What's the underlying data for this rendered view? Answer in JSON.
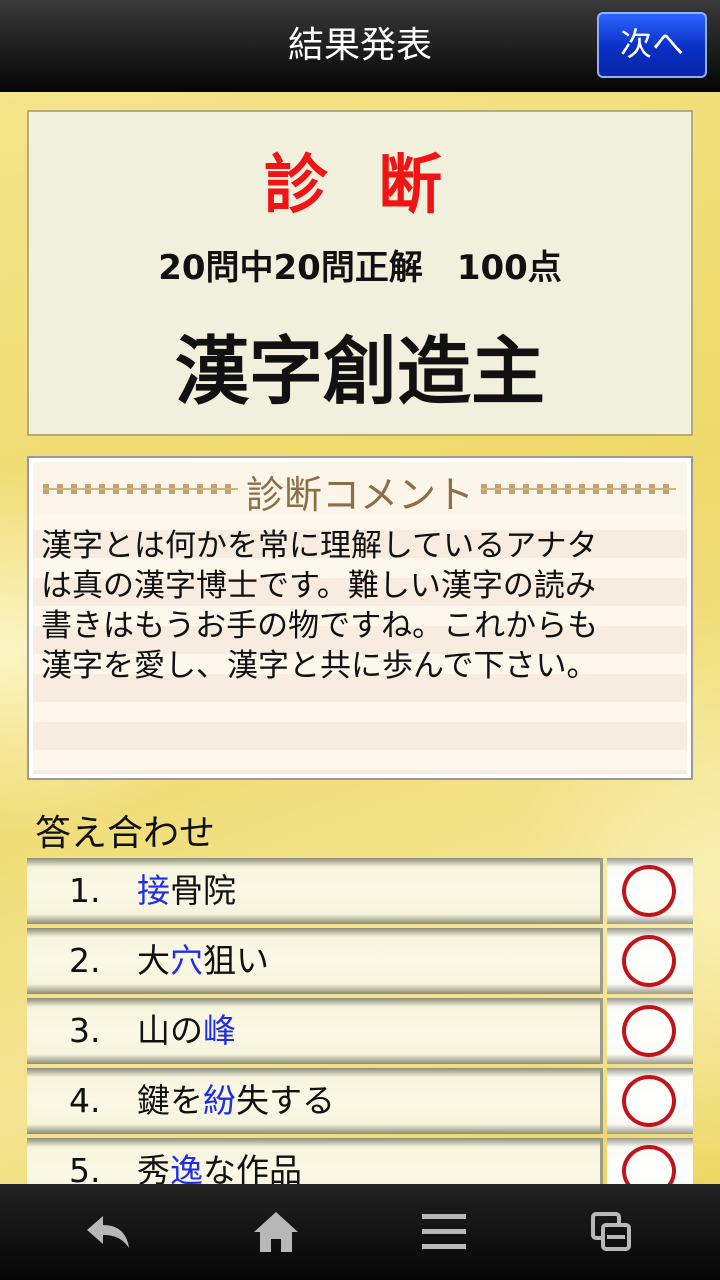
{
  "header": {
    "title": "結果発表",
    "next_label": "次へ"
  },
  "diagnosis": {
    "title": "診 断",
    "score": "20問中20問正解　100点",
    "rank": "漢字創造主"
  },
  "comment": {
    "label": "診断コメント",
    "lines": [
      "漢字とは何かを常に理解しているアナタ",
      "は真の漢字博士です。難しい漢字の読み",
      "書きはもうお手の物ですね。これからも",
      "漢字を愛し、漢字と共に歩んで下さい。"
    ]
  },
  "answers": {
    "heading": "答え合わせ",
    "items": [
      {
        "num": "1.",
        "before": "",
        "hl": "接",
        "after": "骨院",
        "mark": "○"
      },
      {
        "num": "2.",
        "before": "大",
        "hl": "穴",
        "after": "狙い",
        "mark": "○"
      },
      {
        "num": "3.",
        "before": "山の",
        "hl": "峰",
        "after": "",
        "mark": "○"
      },
      {
        "num": "4.",
        "before": "鍵を",
        "hl": "紛",
        "after": "失する",
        "mark": "○"
      },
      {
        "num": "5.",
        "before": "秀",
        "hl": "逸",
        "after": "な作品",
        "mark": "○"
      }
    ]
  },
  "navbar": {
    "icons": [
      "back-icon",
      "home-icon",
      "menu-icon",
      "recent-apps-icon"
    ]
  },
  "colors": {
    "highlight": "#1e2ee8",
    "diagnosis_title": "#f01414",
    "correct_mark": "#c0141a",
    "next_button": "#0a2fc4"
  }
}
